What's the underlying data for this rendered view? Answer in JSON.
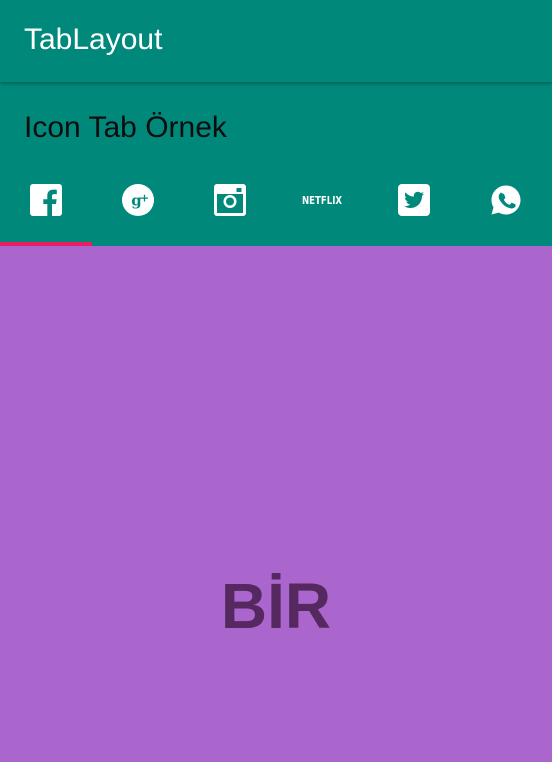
{
  "app_bar": {
    "title": "TabLayout"
  },
  "header": {
    "title": "Icon Tab Örnek"
  },
  "tabs": [
    {
      "icon": "facebook-icon",
      "selected": true
    },
    {
      "icon": "google-plus-icon",
      "selected": false
    },
    {
      "icon": "instagram-icon",
      "selected": false
    },
    {
      "icon": "netflix-icon",
      "text": "NETFLIX",
      "selected": false
    },
    {
      "icon": "twitter-icon",
      "selected": false
    },
    {
      "icon": "whatsapp-icon",
      "selected": false
    }
  ],
  "content": {
    "label": "BİR"
  },
  "colors": {
    "primary": "#00897b",
    "indicator": "#e91e63",
    "content_background": "#aa66cc",
    "content_text": "#55285f"
  }
}
